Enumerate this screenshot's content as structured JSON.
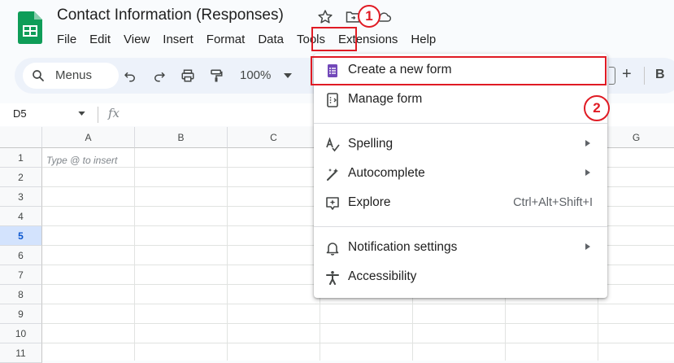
{
  "header": {
    "title": "Contact Information (Responses)",
    "star_icon": "star-icon",
    "move_icon": "move-to-folder-icon",
    "cloud_icon": "cloud-status-icon"
  },
  "menubar": {
    "items": [
      "File",
      "Edit",
      "View",
      "Insert",
      "Format",
      "Data",
      "Tools",
      "Extensions",
      "Help"
    ]
  },
  "toolbar": {
    "search_label": "Menus",
    "zoom": "100%",
    "bold_label": "B",
    "plus_label": "+"
  },
  "formula_bar": {
    "name_box": "D5",
    "fx_label": "fx"
  },
  "grid": {
    "columns": [
      "A",
      "B",
      "C",
      "G"
    ],
    "rows": [
      "1",
      "2",
      "3",
      "4",
      "5",
      "6",
      "7",
      "8",
      "9",
      "10",
      "11"
    ],
    "selected_row": "5",
    "cell_a1_hint": "Type @ to insert"
  },
  "tools_menu": {
    "items": [
      {
        "label": "Create a new form",
        "icon": "forms-icon"
      },
      {
        "label": "Manage form",
        "icon": "manage-form-icon"
      },
      {
        "label": "Spelling",
        "icon": "spelling-icon",
        "submenu": true
      },
      {
        "label": "Autocomplete",
        "icon": "autocomplete-icon",
        "submenu": true
      },
      {
        "label": "Explore",
        "icon": "explore-icon",
        "shortcut": "Ctrl+Alt+Shift+I"
      },
      {
        "label": "Notification settings",
        "icon": "bell-icon",
        "submenu": true
      },
      {
        "label": "Accessibility",
        "icon": "accessibility-icon"
      }
    ]
  },
  "annotations": {
    "step1": "1",
    "step2": "2"
  },
  "colors": {
    "accent": "#0b57d0",
    "annotation": "#e01b24",
    "forms_purple": "#7248b9",
    "sheets_green": "#0f9d58"
  }
}
